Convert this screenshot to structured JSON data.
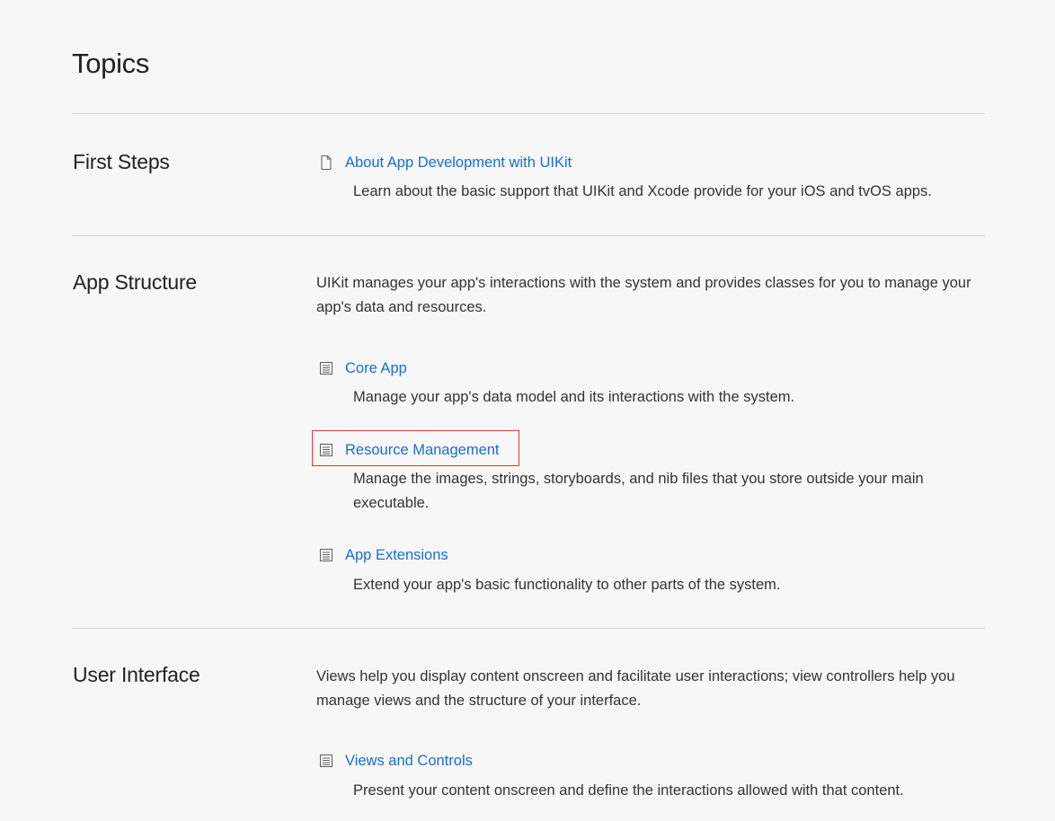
{
  "page": {
    "title": "Topics"
  },
  "sections": [
    {
      "heading": "First Steps",
      "description": "",
      "topics": [
        {
          "icon": "document-icon",
          "label": "About App Development with UIKit",
          "description": "Learn about the basic support that UIKit and Xcode provide for your iOS and tvOS apps."
        }
      ]
    },
    {
      "heading": "App Structure",
      "description": "UIKit manages your app's interactions with the system and provides classes for you to manage your app's data and resources.",
      "topics": [
        {
          "icon": "collection-icon",
          "label": "Core App",
          "description": "Manage your app's data model and its interactions with the system."
        },
        {
          "icon": "collection-icon",
          "label": "Resource Management",
          "description": "Manage the images, strings, storyboards, and nib files that you store outside your main executable."
        },
        {
          "icon": "collection-icon",
          "label": "App Extensions",
          "description": "Extend your app's basic functionality to other parts of the system."
        }
      ]
    },
    {
      "heading": "User Interface",
      "description": "Views help you display content onscreen and facilitate user interactions; view controllers help you manage views and the structure of your interface.",
      "topics": [
        {
          "icon": "collection-icon",
          "label": "Views and Controls",
          "description": "Present your content onscreen and define the interactions allowed with that content."
        }
      ]
    }
  ],
  "colors": {
    "link": "#1a6fc8",
    "highlight": "#d93a3a",
    "rule": "#d6d6d6",
    "background": "#f7f7f7"
  }
}
